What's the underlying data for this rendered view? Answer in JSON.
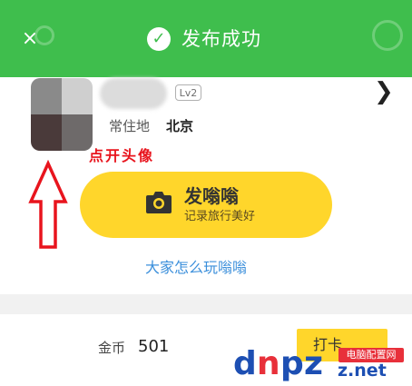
{
  "toast": {
    "close_icon": "×",
    "check_icon": "✓",
    "message": "发布成功",
    "background": "#3fbe4d"
  },
  "profile": {
    "level": "Lv2",
    "residence_label": "常住地",
    "residence_city": "北京",
    "chevron_icon": "❯"
  },
  "annotation": {
    "text": "点开头像",
    "color": "#e8141d"
  },
  "post": {
    "title": "发嗡嗡",
    "subtitle": "记录旅行美好",
    "accent": "#ffd62b"
  },
  "howto_link": "大家怎么玩嗡嗡",
  "coins": {
    "label": "金币",
    "value": "501",
    "checkin_label": "打卡"
  },
  "watermark": {
    "letters": [
      "d",
      "n",
      "p",
      "z"
    ],
    "site": "电脑配置网",
    "domain": "z.net"
  }
}
